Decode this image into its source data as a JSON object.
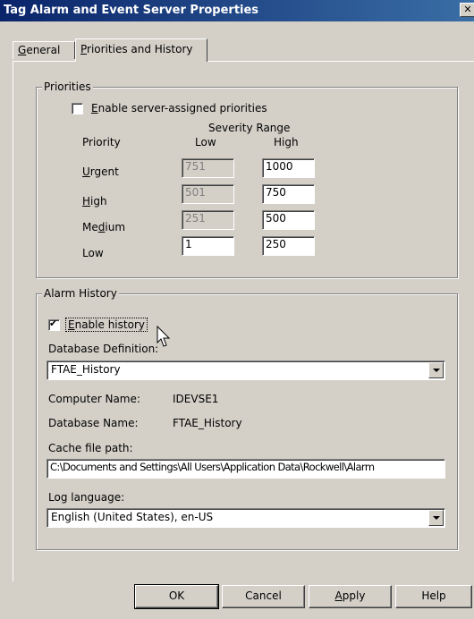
{
  "window": {
    "title": "Tag Alarm and Event Server Properties",
    "close_glyph": "✕"
  },
  "tabs": [
    {
      "pre": "",
      "key": "G",
      "post": "eneral"
    },
    {
      "pre": "",
      "key": "P",
      "post": "riorities and History"
    }
  ],
  "priorities": {
    "legend": "Priorities",
    "enable_cb": {
      "pre": "",
      "key": "E",
      "post": "nable server-assigned priorities",
      "checked": false
    },
    "severity_range": "Severity Range",
    "col_priority": "Priority",
    "col_low": "Low",
    "col_high": "High",
    "rows": [
      {
        "pre": "",
        "key": "U",
        "post": "rgent",
        "low": "751",
        "high": "1000"
      },
      {
        "pre": "",
        "key": "H",
        "post": "igh",
        "low": "501",
        "high": "750"
      },
      {
        "pre": "Me",
        "key": "d",
        "post": "ium",
        "low": "251",
        "high": "500"
      },
      {
        "pre": "Low",
        "key": "",
        "post": "",
        "low": "1",
        "high": "250"
      }
    ]
  },
  "alarm_history": {
    "legend": "Alarm History",
    "enable_cb": {
      "pre": "",
      "key": "E",
      "post": "nable history",
      "checked": true,
      "check_glyph": "✔"
    },
    "db_def_label": "Database Definition:",
    "db_def_value": "FTAE_History",
    "computer_name_label": "Computer Name:",
    "computer_name_value": "IDEVSE1",
    "database_name_label": "Database Name:",
    "database_name_value": "FTAE_History",
    "cache_label": "Cache file path:",
    "cache_value": "C:\\Documents and Settings\\All Users\\Application Data\\Rockwell\\Alarm",
    "log_lang_label": "Log language:",
    "log_lang_value": "English (United States), en-US"
  },
  "buttons": {
    "ok": {
      "pre": "",
      "key": "",
      "post": "OK"
    },
    "cancel": {
      "pre": "",
      "key": "",
      "post": "Cancel"
    },
    "apply": {
      "pre": "",
      "key": "A",
      "post": "pply"
    },
    "help": {
      "pre": "",
      "key": "",
      "post": "Help"
    }
  },
  "icons": {
    "cursor": "mouse-pointer-icon",
    "dropdown": "chevron-down-icon",
    "close": "close-icon",
    "check": "checkmark-icon"
  }
}
